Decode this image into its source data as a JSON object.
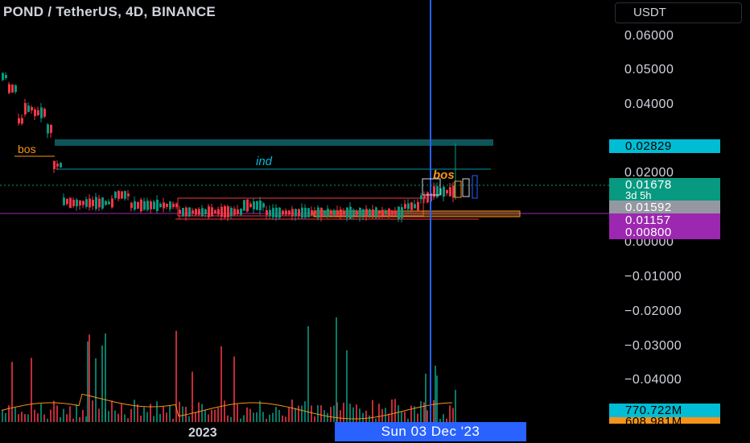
{
  "header": {
    "symbol_title": "POND / TetherUS, 4D, BINANCE",
    "currency_button": "USDT"
  },
  "price_axis": {
    "labels": [
      "0.06000",
      "0.05000",
      "0.04000",
      "0.02000",
      "0.00000",
      "−0.01000",
      "−0.02000",
      "−0.03000",
      "−0.04000"
    ]
  },
  "price_tags": {
    "high_line": {
      "value": "0.02829",
      "color": "#00bcd4",
      "text_color": "#000000"
    },
    "last_price": {
      "value": "0.01678",
      "color": "#089981",
      "text_color": "#ffffff"
    },
    "countdown": "3d 5h",
    "crosshair_price": {
      "value": "0.01592",
      "color": "#9598a1",
      "text_color": "#ffffff"
    },
    "purple_1": {
      "value": "0.01157",
      "color": "#9c27b0",
      "text_color": "#ffffff"
    },
    "purple_2": {
      "value": "0.00800",
      "color": "#9c27b0",
      "text_color": "#ffffff"
    },
    "volume": {
      "value": "770.722M",
      "color": "#00bcd4",
      "text_color": "#000000"
    },
    "volume_ma": {
      "value": "608.981M",
      "color": "#f7931a",
      "text_color": "#000000"
    }
  },
  "annotations": {
    "bos_left": "bos",
    "ind": "ind",
    "bos_right": "bos"
  },
  "time_axis": {
    "year_label": "2023",
    "crosshair_date": "Sun 03 Dec '23"
  },
  "colors": {
    "up": "#089981",
    "down": "#f23645",
    "crosshair": "#2962ff",
    "level_line": "#00bcd4",
    "purple": "#9c27b0",
    "orange": "#f7931a"
  }
}
